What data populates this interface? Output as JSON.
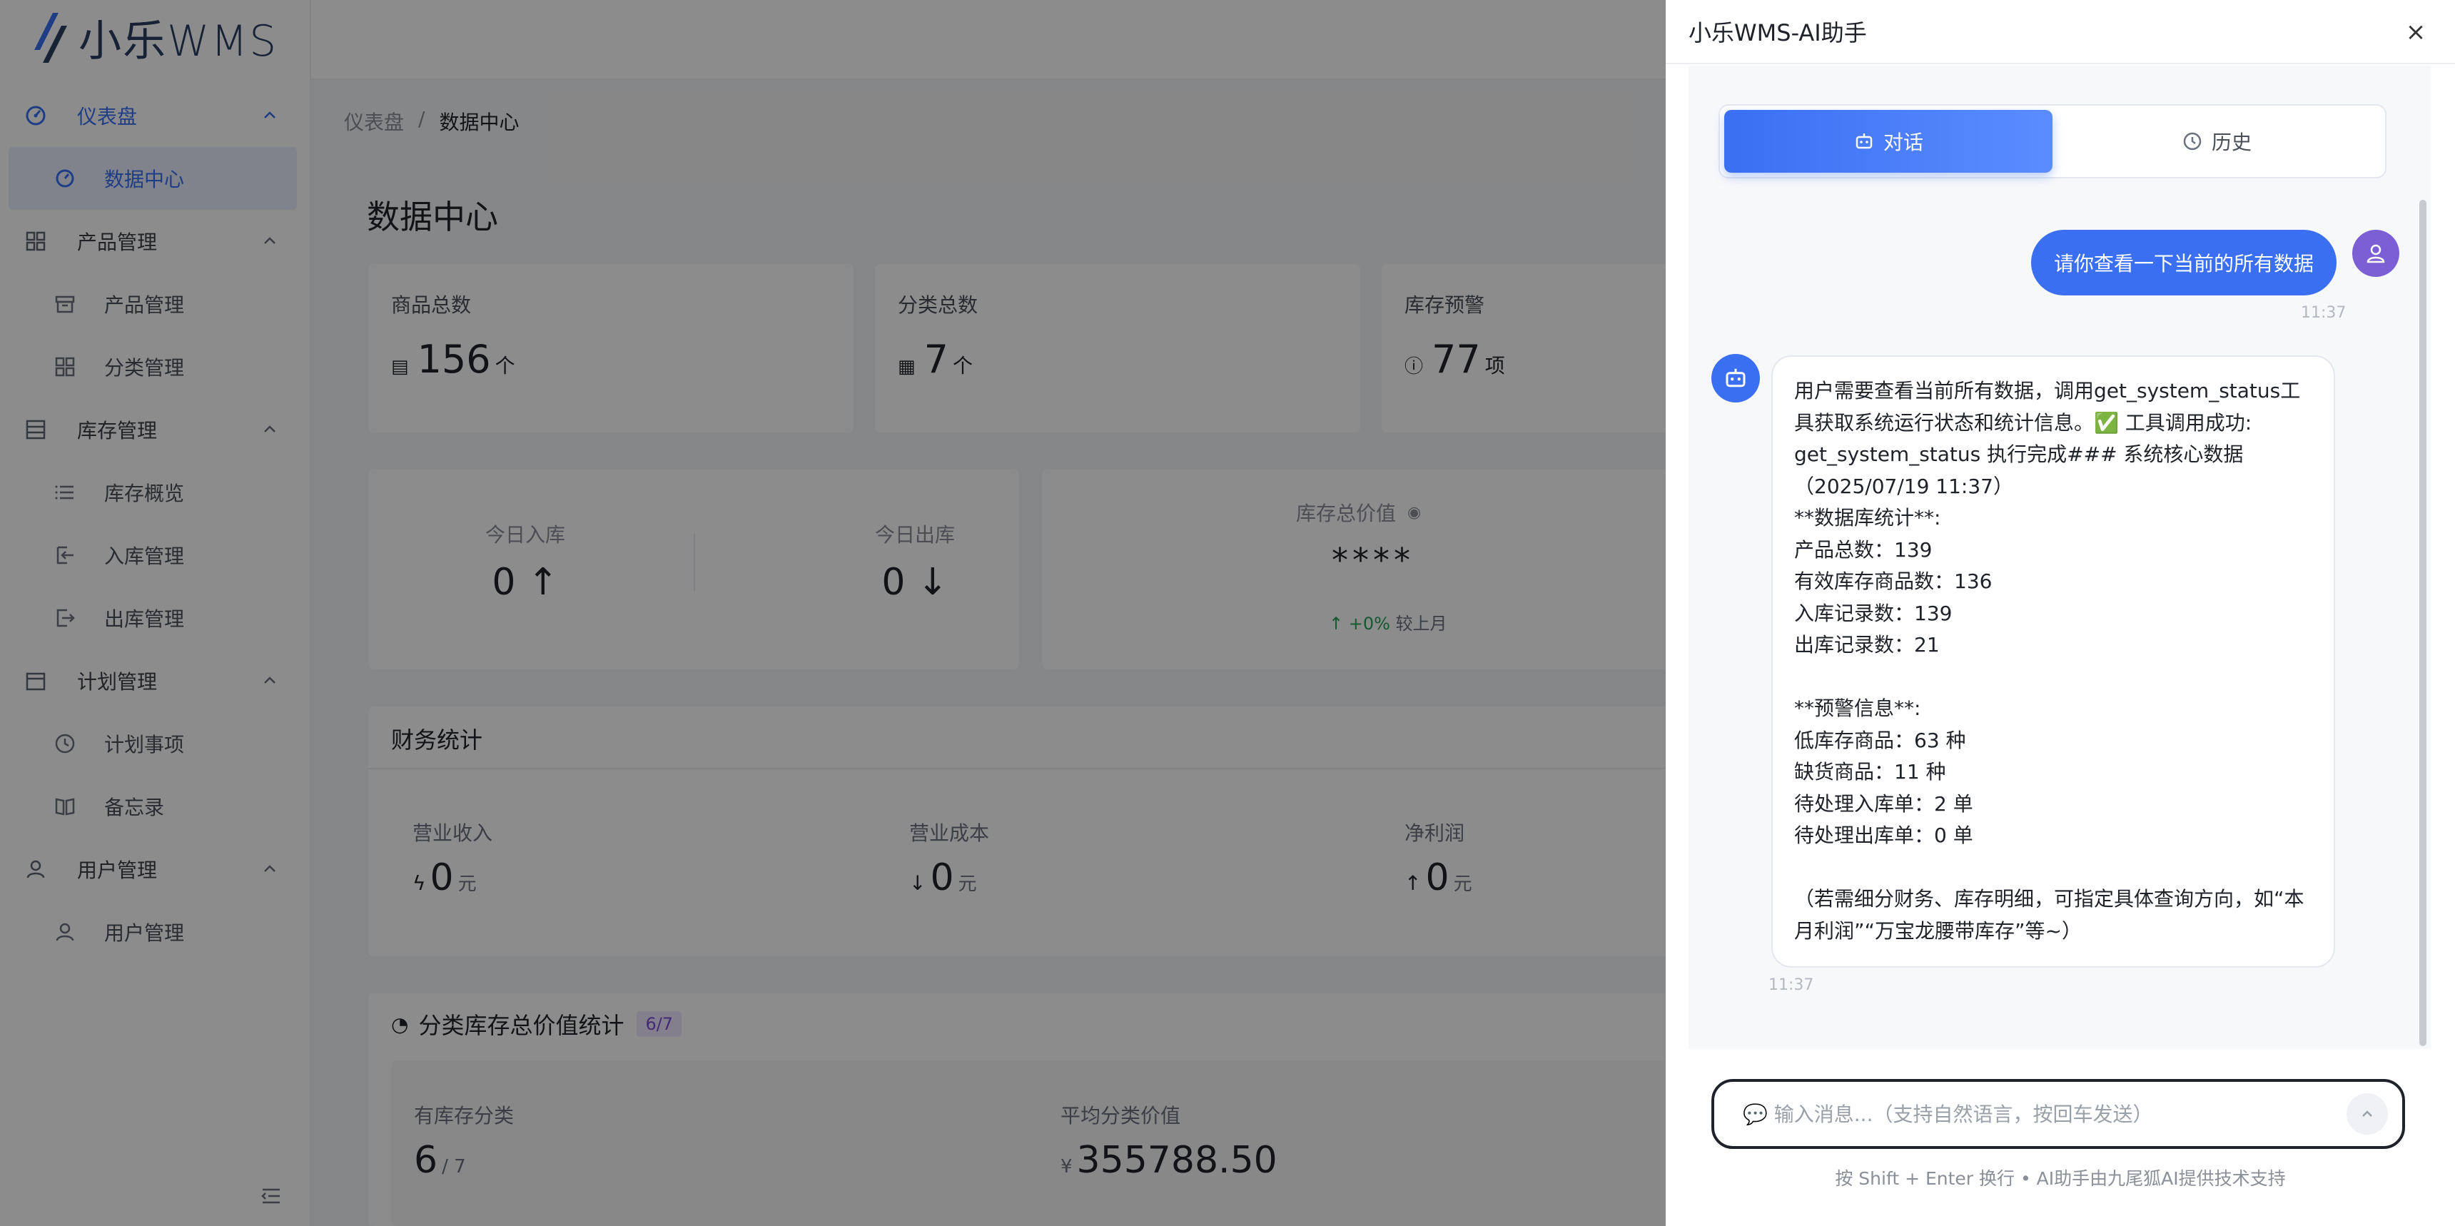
{
  "app": {
    "logo_text": "小乐WMS"
  },
  "sidebar": {
    "groups": [
      {
        "label": "仪表盘",
        "items": [
          {
            "label": "数据中心"
          }
        ]
      },
      {
        "label": "产品管理",
        "items": [
          {
            "label": "产品管理"
          },
          {
            "label": "分类管理"
          }
        ]
      },
      {
        "label": "库存管理",
        "items": [
          {
            "label": "库存概览"
          },
          {
            "label": "入库管理"
          },
          {
            "label": "出库管理"
          }
        ]
      },
      {
        "label": "计划管理",
        "items": [
          {
            "label": "计划事项"
          },
          {
            "label": "备忘录"
          }
        ]
      },
      {
        "label": "用户管理",
        "items": [
          {
            "label": "用户管理"
          }
        ]
      }
    ]
  },
  "breadcrumb": {
    "root": "仪表盘",
    "sep": "/",
    "current": "数据中心"
  },
  "page": {
    "title": "数据中心"
  },
  "stats": [
    {
      "label": "商品总数",
      "value": "156",
      "unit": "个"
    },
    {
      "label": "分类总数",
      "value": "7",
      "unit": "个"
    },
    {
      "label": "库存预警",
      "value": "77",
      "unit": "项"
    }
  ],
  "today": {
    "in_label": "今日入库",
    "in_value": "0",
    "in_arrow": "↑",
    "out_label": "今日出库",
    "out_value": "0",
    "out_arrow": "↓",
    "total_label": "库存总价值",
    "total_value": "****",
    "change": "↑ +0%",
    "change_suffix": "较上月"
  },
  "finance": {
    "title": "财务统计",
    "items": [
      {
        "label": "营业收入",
        "value": "0",
        "unit": "元"
      },
      {
        "label": "营业成本",
        "value": "0",
        "unit": "元"
      },
      {
        "label": "净利润",
        "value": "0",
        "unit": "元"
      }
    ]
  },
  "category": {
    "title": "分类库存总价值统计",
    "badge": "6/7",
    "has_stock_label": "有库存分类",
    "has_stock_value": "6",
    "has_stock_total": "/ 7",
    "avg_label": "平均分类价值",
    "avg_currency": "¥",
    "avg_value": "355788.50"
  },
  "ai": {
    "title": "小乐WMS-AI助手",
    "close": "×",
    "tabs": [
      {
        "label": "对话"
      },
      {
        "label": "历史"
      }
    ],
    "user_message": "请你查看一下当前的所有数据",
    "user_time": "11:37",
    "bot_message": "用户需要查看当前所有数据，调用get_system_status工具获取系统运行状态和统计信息。✅ 工具调用成功: get_system_status 执行完成### 系统核心数据（2025/07/19 11:37）\n**数据库统计**:\n产品总数：139\n有效库存商品数：136\n入库记录数：139\n出库记录数：21\n\n**预警信息**:\n低库存商品：63 种\n缺货商品：11 种\n待处理入库单：2 单\n待处理出库单：0 单\n\n（若需细分财务、库存明细，可指定具体查询方向，如“本月利润”“万宝龙腰带库存”等~）",
    "bot_time": "11:37",
    "input_placeholder": "💬 输入消息...（支持自然语言，按回车发送）",
    "footer_hint": "按 Shift + Enter 换行 • AI助手由九尾狐AI提供技术支持"
  }
}
